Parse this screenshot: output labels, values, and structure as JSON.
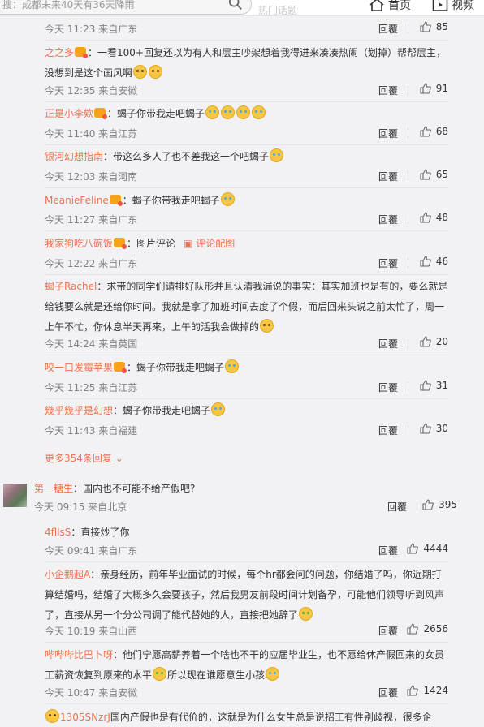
{
  "topbar": {
    "search_placeholder": "搜：成都未来40天有36天降雨",
    "hot_text": "热门话题",
    "nav_home": "首页",
    "nav_video": "视频"
  },
  "replies_a": [
    {
      "time": "今天 11:23 来自广东",
      "likes": "85",
      "meta_only": true
    },
    {
      "user": "之之多",
      "vip": true,
      "text": "：一看100+回复还以为有人和层主吵架想着我得进来凑凑热闹（划掉）帮帮层主，没想到是这个画风啊",
      "emoji_tail": 2,
      "emoji_kind": "laugh",
      "time": "今天 12:35 来自安徽",
      "likes": "91"
    },
    {
      "user": "正是小李欸",
      "vip": true,
      "text": "：蝎子你带我走吧蝎子",
      "emoji_tail": 4,
      "emoji_kind": "cry",
      "time": "今天 11:40 来自江苏",
      "likes": "68"
    },
    {
      "user": "银河幻想指南",
      "vip": false,
      "text": "：带这么多人了也不差我这一个吧蝎子",
      "emoji_tail": 1,
      "emoji_kind": "cry",
      "time": "今天 12:03 来自河南",
      "likes": "65"
    },
    {
      "user": "MeanieFeline",
      "vip": true,
      "text": "：蝎子你带我走吧蝎子",
      "emoji_tail": 1,
      "emoji_kind": "cry",
      "time": "今天 11:27 来自广东",
      "likes": "48"
    },
    {
      "user": "我家狗吃八碗饭",
      "vip": true,
      "text": "：图片评论",
      "pic_link": "评论配图",
      "emoji_tail": 0,
      "time": "今天 12:22 来自广东",
      "likes": "46"
    },
    {
      "user": "蝎子Rachel",
      "vip": false,
      "text": "：求带的同学们请排好队形并且认清我漏说的事实：其实加班也是有的，要么就是给钱要么就是还给你时间。我就是拿了加班时间去度了个假，而后回来头说之前太忙了，周一上午不忙，你休息半天再来，上午的活我会做掉的",
      "emoji_tail": 1,
      "emoji_kind": "laugh",
      "time": "今天 14:24 来自英国",
      "likes": "20"
    },
    {
      "user": "咬一口发霉苹果",
      "vip": true,
      "text": "：蝎子你带我走吧蝎子",
      "emoji_tail": 1,
      "emoji_kind": "cry",
      "time": "今天 11:25 来自江苏",
      "likes": "31"
    },
    {
      "user": "幾乎幾乎是幻想",
      "vip": false,
      "text": "：蝎子你带我走吧蝎子",
      "emoji_tail": 1,
      "emoji_kind": "cry",
      "time": "今天 11:43 来自福建",
      "likes": "30"
    }
  ],
  "more_replies": "更多354条回复",
  "reply_label": "回覆",
  "main_comment": {
    "user": "第一糖生",
    "text": "：国内也不可能不给产假吧?",
    "time": "今天 09:15 来自北京",
    "likes": "395"
  },
  "replies_b": [
    {
      "user": "4fllsS",
      "text": "：直接炒了你",
      "emoji_tail": 0,
      "time": "今天 09:41 来自广东",
      "likes": "4444"
    },
    {
      "user": "小企鹅超A",
      "text": "：亲身经历，前年毕业面试的时候，每个hr都会问的问题，你结婚了吗，你近期打算结婚吗，结婚了大概多久会要孩子，然后我男友前段时间计划备孕，可能他们领导听到风声了，直接从另一个分公司调了能代替她的人，直接把她辞了",
      "emoji_tail": 1,
      "emoji_kind": "plain",
      "time": "今天 10:19 来自山西",
      "likes": "2656"
    },
    {
      "user": "哔哔哔比巴卜呀",
      "text": "：他们宁愿高薪养着一个啥也不干的应届毕业生，也不愿给休产假回来的女员工薪资恢复到原来的水平",
      "mid_emoji": true,
      "text2": "所以现在谁愿意生小孩",
      "emoji_tail": 1,
      "emoji_kind": "cry",
      "time": "今天 10:47 来自安徽",
      "likes": "1424"
    },
    {
      "user": "1305SNzrJ",
      "lead_emoji": true,
      "text": "国内产假也是有代价的，这就是为什么女生总是说招工有性别歧视，很多企",
      "emoji_tail": 0,
      "time": "",
      "likes": ""
    }
  ],
  "colors": {
    "accent": "#eb7350",
    "background": "#f2f2f5"
  }
}
